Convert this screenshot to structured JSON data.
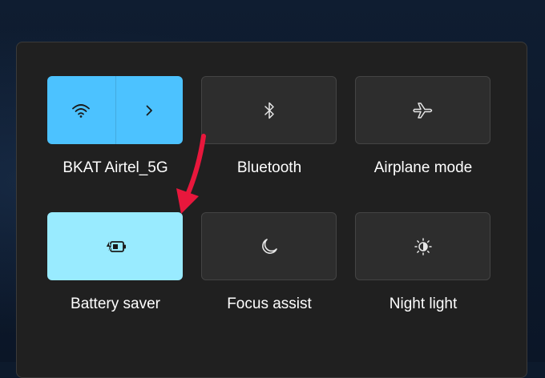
{
  "quick_settings": {
    "tiles": [
      {
        "label": "BKAT Airtel_5G",
        "icon": "wifi-icon",
        "secondary_icon": "chevron-right-icon",
        "state": "on"
      },
      {
        "label": "Bluetooth",
        "icon": "bluetooth-icon",
        "state": "off"
      },
      {
        "label": "Airplane mode",
        "icon": "airplane-icon",
        "state": "off"
      },
      {
        "label": "Battery saver",
        "icon": "battery-saver-icon",
        "state": "on"
      },
      {
        "label": "Focus assist",
        "icon": "moon-icon",
        "state": "off"
      },
      {
        "label": "Night light",
        "icon": "brightness-icon",
        "state": "off"
      }
    ]
  },
  "annotation": {
    "icon": "arrow-icon",
    "color": "#e8173c",
    "points_to": "Battery saver"
  },
  "colors": {
    "accent_on": "#4cc2ff",
    "accent_on_light": "#99ebff",
    "tile_off": "#2d2d2d",
    "panel": "#202020"
  }
}
